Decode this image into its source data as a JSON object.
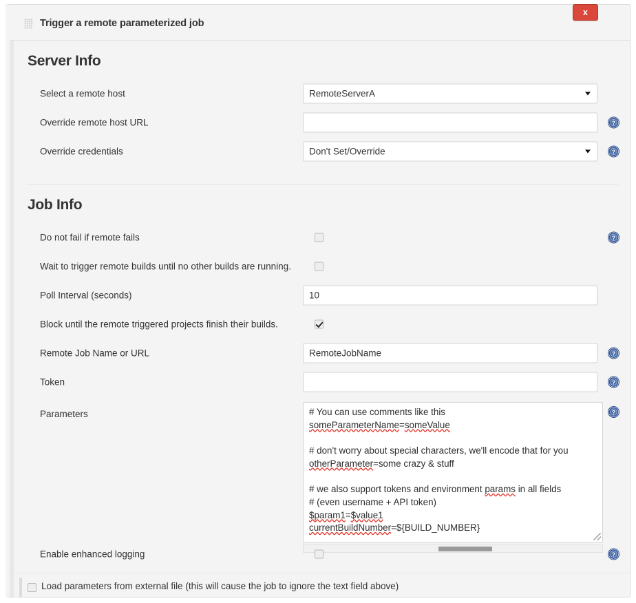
{
  "header": {
    "title": "Trigger a remote parameterized job",
    "drag_handle_icon": "drag-grip-icon",
    "close_label": "x"
  },
  "sections": [
    {
      "title": "Server Info",
      "rows": [
        {
          "label": "Select a remote host",
          "control": "select",
          "value": "RemoteServerA",
          "help": false
        },
        {
          "label": "Override remote host URL",
          "control": "text",
          "value": "",
          "placeholder": "",
          "help": true
        },
        {
          "label": "Override credentials",
          "control": "select",
          "value": "Don't Set/Override",
          "help": true
        }
      ]
    },
    {
      "title": "Job Info",
      "rows": [
        {
          "label": "Do not fail if remote fails",
          "control": "checkbox",
          "checked": false,
          "help": true
        },
        {
          "label": "Wait to trigger remote builds until no other builds are running.",
          "control": "checkbox",
          "checked": false,
          "help": false
        },
        {
          "label": "Poll Interval (seconds)",
          "control": "text",
          "value": "10",
          "placeholder": "",
          "help": false
        },
        {
          "label": "Block until the remote triggered projects finish their builds.",
          "control": "checkbox",
          "checked": true,
          "help": false
        },
        {
          "label": "Remote Job Name or URL",
          "control": "text",
          "value": "RemoteJobName",
          "placeholder": "",
          "help": true
        },
        {
          "label": "Token",
          "control": "text",
          "value": "",
          "placeholder": "",
          "help": true
        },
        {
          "label": "Parameters",
          "control": "textarea",
          "value": "# You can use comments like this\nsomeParameterName=someValue\n\n# don't worry about special characters, we'll encode that for you\notherParameter=some crazy & stuff\n\n# we also support tokens and environment params in all fields\n# (even username + API token)\n$param1=$value1\ncurrentBuildNumber=${BUILD_NUMBER}",
          "help": true
        },
        {
          "label": "Enable enhanced logging",
          "control": "checkbox",
          "checked": false,
          "help": true
        }
      ]
    }
  ],
  "external_file": {
    "label": "Load parameters from external file (this will cause the job to ignore the text field above)",
    "checked": false
  },
  "icons": {
    "help": "help-circle-icon",
    "dropdown": "chevron-down-icon",
    "resize": "resize-grip-icon"
  },
  "colors": {
    "close_button": "#d9483b",
    "help_icon": "#3b5998",
    "panel_bg": "#f4f4f4",
    "input_border": "#d4d4d4"
  }
}
